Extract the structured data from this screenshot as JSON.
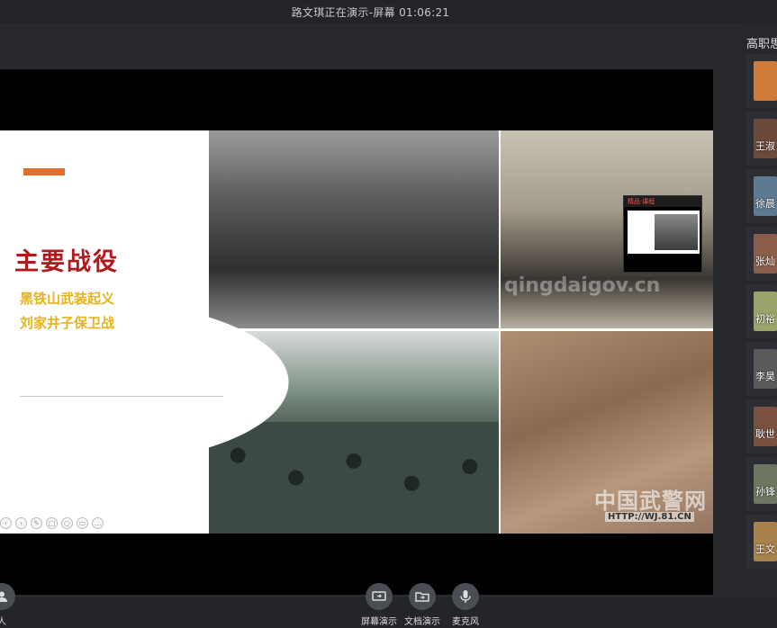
{
  "top": {
    "status": "路文琪正在演示-屏幕 01:06:21"
  },
  "slide": {
    "title": "主要战役",
    "items": [
      "黑铁山武装起义",
      "刘家井子保卫战"
    ],
    "watermarks": [
      "中国武警网",
      "HTTP://WJ.81.CN",
      "qingdaigov.cn"
    ]
  },
  "pip": {
    "header": "精品·课程"
  },
  "sidebar": {
    "title": "高职思",
    "participants": [
      {
        "name": "",
        "color": "#d07a3a"
      },
      {
        "name": "王淑",
        "color": "#6b4a3a"
      },
      {
        "name": "徐晨",
        "color": "#5d7a92"
      },
      {
        "name": "张灿",
        "color": "#8a5e4a"
      },
      {
        "name": "初裕",
        "color": "#9aa36a"
      },
      {
        "name": "李昊",
        "color": "#5a5a5a"
      },
      {
        "name": "耿世",
        "color": "#7a5040"
      },
      {
        "name": "孙锋",
        "color": "#6e7660"
      },
      {
        "name": "王文",
        "color": "#a8824a"
      }
    ]
  },
  "toolbar": {
    "items": [
      {
        "label": "人",
        "icon": "user-icon"
      },
      {
        "label": "屏幕演示",
        "icon": "screen-share-icon"
      },
      {
        "label": "文档演示",
        "icon": "document-share-icon"
      },
      {
        "label": "麦克风",
        "icon": "microphone-icon"
      }
    ]
  },
  "colors": {
    "accent": "#e26e2c",
    "title_red": "#b1191c",
    "item_gold": "#e7b21b"
  }
}
